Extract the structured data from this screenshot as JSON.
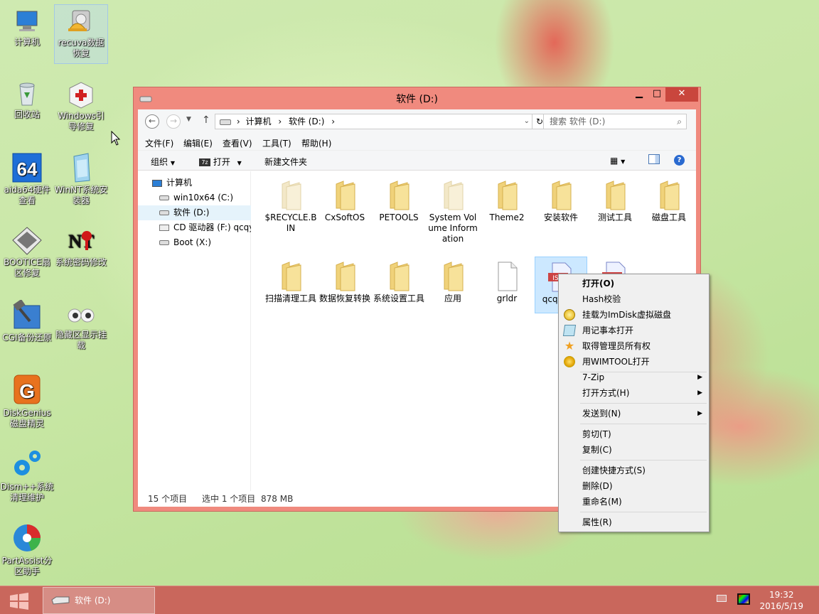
{
  "desktop": {
    "icons": [
      {
        "label": "计算机"
      },
      {
        "label": "recuva数据恢复"
      },
      {
        "label": "回收站"
      },
      {
        "label": "Windows引导修复"
      },
      {
        "label": "aida64硬件查看"
      },
      {
        "label": "WinNT系统安装器"
      },
      {
        "label": "BOOTICE扇区修复"
      },
      {
        "label": "系统密码修改"
      },
      {
        "label": "CGI备份还原"
      },
      {
        "label": "隐藏区显示挂载"
      },
      {
        "label": "DiskGenius磁盘精灵"
      },
      {
        "label": "Dism++系统清理维护"
      },
      {
        "label": "PartAssist分区助手"
      }
    ]
  },
  "window": {
    "title": "软件 (D:)",
    "minimize": "▁",
    "maximize": "□",
    "close": "✕",
    "back": "←",
    "forward": "→",
    "up": "↑",
    "breadcrumb": [
      "计算机",
      "软件 (D:)"
    ],
    "breadcrumb_sep": "›",
    "search_placeholder": "搜索 软件 (D:)",
    "menu": [
      "文件(F)",
      "编辑(E)",
      "查看(V)",
      "工具(T)",
      "帮助(H)"
    ],
    "toolbar": {
      "organize": "组织",
      "open": "打开",
      "new_folder": "新建文件夹"
    },
    "nav": [
      {
        "label": "计算机"
      },
      {
        "label": "win10x64 (C:)"
      },
      {
        "label": "软件 (D:)"
      },
      {
        "label": "CD 驱动器 (F:) qcqy"
      },
      {
        "label": "Boot (X:)"
      }
    ],
    "files": [
      {
        "name": "$RECYCLE.BIN",
        "kind": "folder-faded"
      },
      {
        "name": "CxSoftOS",
        "kind": "folder"
      },
      {
        "name": "PETOOLS",
        "kind": "folder"
      },
      {
        "name": "System Volume Information",
        "kind": "folder-faded"
      },
      {
        "name": "Theme2",
        "kind": "folder"
      },
      {
        "name": "安装软件",
        "kind": "folder"
      },
      {
        "name": "测试工具",
        "kind": "folder"
      },
      {
        "name": "磁盘工具",
        "kind": "folder"
      },
      {
        "name": "扫描清理工具",
        "kind": "folder"
      },
      {
        "name": "数据恢复转换",
        "kind": "folder"
      },
      {
        "name": "系统设置工具",
        "kind": "folder"
      },
      {
        "name": "应用",
        "kind": "folder"
      },
      {
        "name": "grldr",
        "kind": "file"
      },
      {
        "name": "qcqy统...",
        "kind": "iso"
      },
      {
        "name": "",
        "kind": "iso"
      }
    ],
    "status": {
      "count": "15 个项目",
      "selected": "选中 1 个项目",
      "size": "878 MB"
    }
  },
  "context_menu": {
    "items": [
      {
        "label": "打开(O)",
        "bold": true
      },
      {
        "label": "Hash校验"
      },
      {
        "label": "挂载为ImDisk虚拟磁盘",
        "icon": "imdisk-icon"
      },
      {
        "label": "用记事本打开",
        "icon": "notepad-icon"
      },
      {
        "label": "取得管理员所有权",
        "icon": "star-icon"
      },
      {
        "label": "用WIMTOOL打开",
        "icon": "wimtool-icon"
      },
      {
        "label": "7-Zip",
        "submenu": true
      },
      {
        "label": "打开方式(H)",
        "submenu": true
      },
      {
        "label": "发送到(N)",
        "submenu": true
      },
      {
        "label": "剪切(T)"
      },
      {
        "label": "复制(C)"
      },
      {
        "label": "创建快捷方式(S)"
      },
      {
        "label": "删除(D)"
      },
      {
        "label": "重命名(M)"
      },
      {
        "label": "属性(R)"
      }
    ]
  },
  "taskbar": {
    "task": "软件 (D:)",
    "time": "19:32",
    "date": "2016/5/19"
  }
}
